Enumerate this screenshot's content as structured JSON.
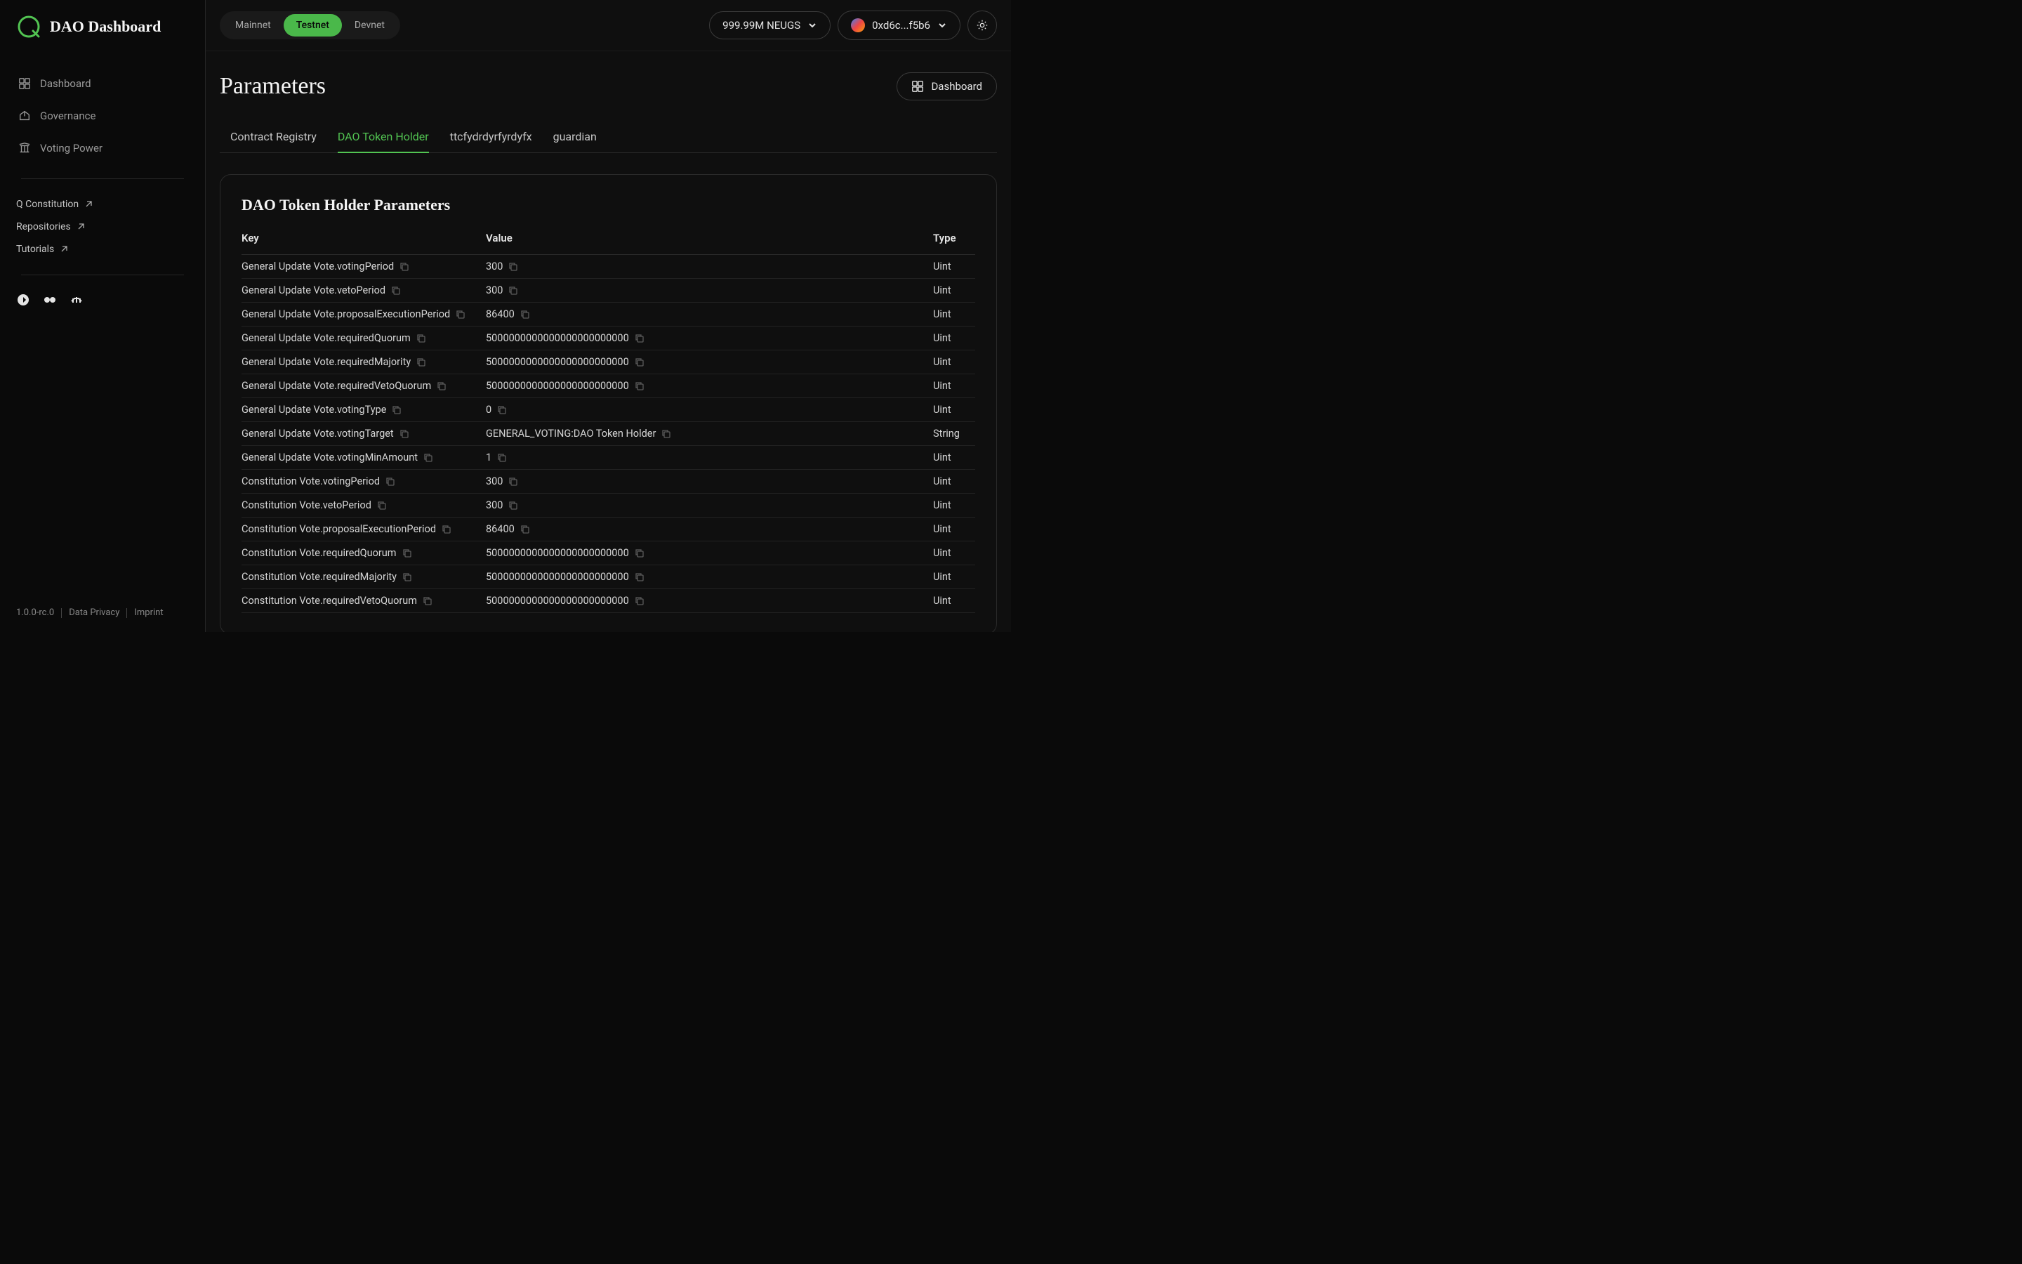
{
  "app_title": "DAO Dashboard",
  "sidebar": {
    "nav": [
      {
        "label": "Dashboard"
      },
      {
        "label": "Governance"
      },
      {
        "label": "Voting Power"
      }
    ],
    "links": [
      {
        "label": "Q Constitution"
      },
      {
        "label": "Repositories"
      },
      {
        "label": "Tutorials"
      }
    ],
    "footer": {
      "version": "1.0.0-rc.0",
      "privacy": "Data Privacy",
      "imprint": "Imprint"
    }
  },
  "topbar": {
    "networks": [
      "Mainnet",
      "Testnet",
      "Devnet"
    ],
    "active_network": 1,
    "balance": "999.99M NEUGS",
    "address": "0xd6c...f5b6"
  },
  "page": {
    "title": "Parameters",
    "dashboard_btn": "Dashboard",
    "tabs": [
      "Contract Registry",
      "DAO Token Holder",
      "ttcfydrdyrfyrdyfx",
      "guardian"
    ],
    "active_tab": 1,
    "panel_title": "DAO Token Holder Parameters",
    "columns": {
      "key": "Key",
      "value": "Value",
      "type": "Type"
    },
    "rows": [
      {
        "key": "General Update Vote.votingPeriod",
        "value": "300",
        "type": "Uint"
      },
      {
        "key": "General Update Vote.vetoPeriod",
        "value": "300",
        "type": "Uint"
      },
      {
        "key": "General Update Vote.proposalExecutionPeriod",
        "value": "86400",
        "type": "Uint"
      },
      {
        "key": "General Update Vote.requiredQuorum",
        "value": "5000000000000000000000000",
        "type": "Uint"
      },
      {
        "key": "General Update Vote.requiredMajority",
        "value": "5000000000000000000000000",
        "type": "Uint"
      },
      {
        "key": "General Update Vote.requiredVetoQuorum",
        "value": "5000000000000000000000000",
        "type": "Uint"
      },
      {
        "key": "General Update Vote.votingType",
        "value": "0",
        "type": "Uint"
      },
      {
        "key": "General Update Vote.votingTarget",
        "value": "GENERAL_VOTING:DAO Token Holder",
        "type": "String"
      },
      {
        "key": "General Update Vote.votingMinAmount",
        "value": "1",
        "type": "Uint"
      },
      {
        "key": "Constitution Vote.votingPeriod",
        "value": "300",
        "type": "Uint"
      },
      {
        "key": "Constitution Vote.vetoPeriod",
        "value": "300",
        "type": "Uint"
      },
      {
        "key": "Constitution Vote.proposalExecutionPeriod",
        "value": "86400",
        "type": "Uint"
      },
      {
        "key": "Constitution Vote.requiredQuorum",
        "value": "5000000000000000000000000",
        "type": "Uint"
      },
      {
        "key": "Constitution Vote.requiredMajority",
        "value": "5000000000000000000000000",
        "type": "Uint"
      },
      {
        "key": "Constitution Vote.requiredVetoQuorum",
        "value": "5000000000000000000000000",
        "type": "Uint"
      }
    ]
  }
}
